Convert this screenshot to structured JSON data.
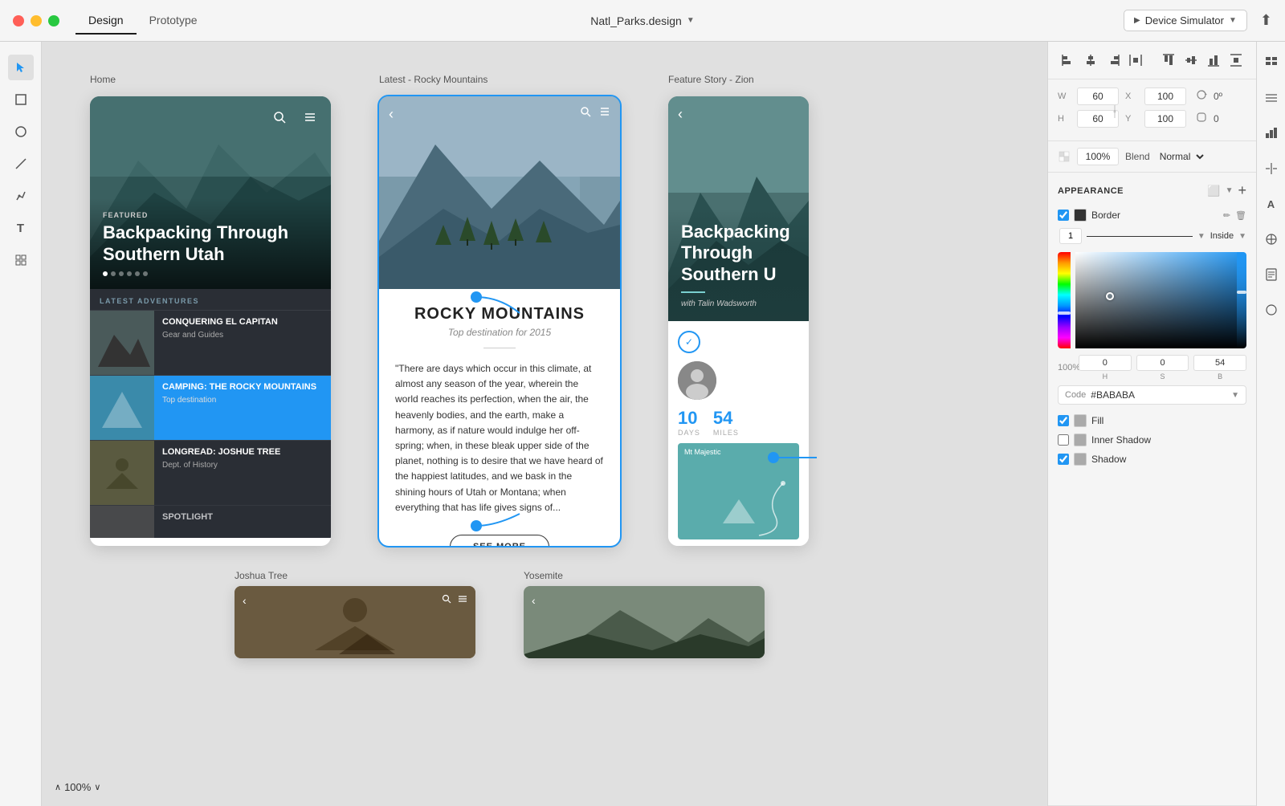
{
  "titlebar": {
    "tabs": [
      {
        "id": "design",
        "label": "Design",
        "active": true
      },
      {
        "id": "prototype",
        "label": "Prototype",
        "active": false
      }
    ],
    "filename": "Natl_Parks.design",
    "device_sim_label": "Device Simulator",
    "export_icon": "↑"
  },
  "left_toolbar": {
    "tools": [
      {
        "id": "select",
        "icon": "▲",
        "active": true
      },
      {
        "id": "rectangle",
        "icon": "□",
        "active": false
      },
      {
        "id": "oval",
        "icon": "○",
        "active": false
      },
      {
        "id": "line",
        "icon": "/",
        "active": false
      },
      {
        "id": "pen",
        "icon": "✒",
        "active": false
      },
      {
        "id": "text",
        "icon": "T",
        "active": false
      },
      {
        "id": "symbol",
        "icon": "⊡",
        "active": false
      }
    ]
  },
  "canvas": {
    "phone1": {
      "label": "Home",
      "hero": {
        "tag": "FEATURED",
        "title": "Backpacking Through Southern Utah"
      },
      "list_header": "LATEST ADVENTURES",
      "items": [
        {
          "title": "CONQUERING EL CAPITAN",
          "sub": "Gear and Guides",
          "highlighted": false
        },
        {
          "title": "CAMPING: THE ROCKY MOUNTAINS",
          "sub": "Top destination",
          "highlighted": true
        },
        {
          "title": "LONGREAD: JOSHUE TREE",
          "sub": "Dept. of History",
          "highlighted": false
        },
        {
          "title": "SPOTLIGHT",
          "sub": "",
          "highlighted": false
        }
      ]
    },
    "phone2": {
      "label": "Latest - Rocky Mountains",
      "hero_label": "ROCKY MOUNTAINS",
      "subtitle": "Top destination for 2015",
      "quote": "\"There are days which occur in this climate, at almost any season of the year, wherein the world reaches its perfection, when the air, the heavenly bodies, and the earth, make a harmony, as if nature would indulge her off-spring; when, in these bleak upper side of the planet, nothing is to desire that we have heard of the happiest latitudes, and we bask in the shining hours of Utah or Montana; when everything that has life gives signs of...",
      "see_more_label": "SEE MORE"
    },
    "phone3": {
      "label": "Feature Story - Zion",
      "title": "Backpacking Through Southern U",
      "author": "with Talin Wadsworth",
      "days": "10",
      "days_label": "DAYS",
      "miles": "54",
      "miles_label": "MILES",
      "map_label": "Mt Majestic"
    },
    "phone4": {
      "label": "Joshua Tree"
    },
    "phone5": {
      "label": "Yosemite"
    }
  },
  "right_panel": {
    "alignment": {
      "groups": [
        [
          "⬛",
          "⬛",
          "⬛",
          "⬛"
        ],
        [
          "⬛",
          "⬛",
          "⬛",
          "⬛"
        ]
      ]
    },
    "dimensions": {
      "w_label": "W",
      "w_value": "60",
      "x_label": "X",
      "x_value": "100",
      "rotate_label": "0º",
      "h_label": "H",
      "h_value": "60",
      "y_label": "Y",
      "y_value": "100",
      "corners_value": "0"
    },
    "opacity_value": "100%",
    "blend_label": "Blend",
    "blend_value": "Normal",
    "appearance_title": "APPEARANCE",
    "border": {
      "enabled": true,
      "label": "Border",
      "thickness": "1",
      "align": "Inside"
    },
    "color_picker": {
      "h_label": "H",
      "h_value": "0",
      "s_label": "S",
      "s_value": "0",
      "b_label": "B",
      "b_value": "54",
      "code_label": "Code",
      "hex_value": "#BABABA"
    },
    "fill": {
      "enabled": true,
      "label": "Fill"
    },
    "inner_shadow": {
      "enabled": false,
      "label": "Inner Shadow"
    },
    "shadow": {
      "enabled": true,
      "label": "Shadow"
    }
  },
  "zoom": {
    "value": "100%"
  }
}
